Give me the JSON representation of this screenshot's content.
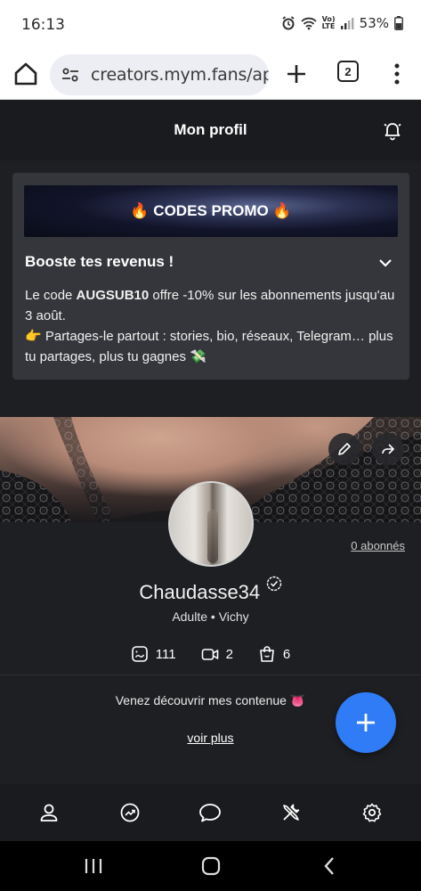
{
  "status_bar": {
    "time": "16:13",
    "network": "Vo) LTE",
    "battery": "53%"
  },
  "browser": {
    "url": "creators.mym.fans/app",
    "tab_count": "2"
  },
  "header": {
    "title": "Mon profil"
  },
  "promo": {
    "banner": "🔥 CODES PROMO 🔥",
    "heading": "Booste tes revenus !",
    "line1_prefix": "Le code ",
    "code": "AUGSUB10",
    "line1_suffix": " offre -10% sur les abonnements jusqu'au 3 août.",
    "line2": "👉 Partages-le partout : stories, bio, réseaux, Telegram… plus tu partages, plus tu gagnes 💸"
  },
  "profile": {
    "followers": "0 abonnés",
    "username": "Chaudasse34",
    "subtitle": "Adulte • Vichy",
    "stats": {
      "photos": "111",
      "videos": "2",
      "products": "6"
    },
    "bio": "Venez découvrir mes contenue 👅",
    "see_more": "voir plus"
  },
  "bottom_nav": [
    "profile-icon",
    "stats-icon",
    "chat-icon",
    "tools-icon",
    "settings-icon"
  ],
  "colors": {
    "background": "#1e1f22",
    "card": "#34363b",
    "accent": "#2f7cf6"
  }
}
